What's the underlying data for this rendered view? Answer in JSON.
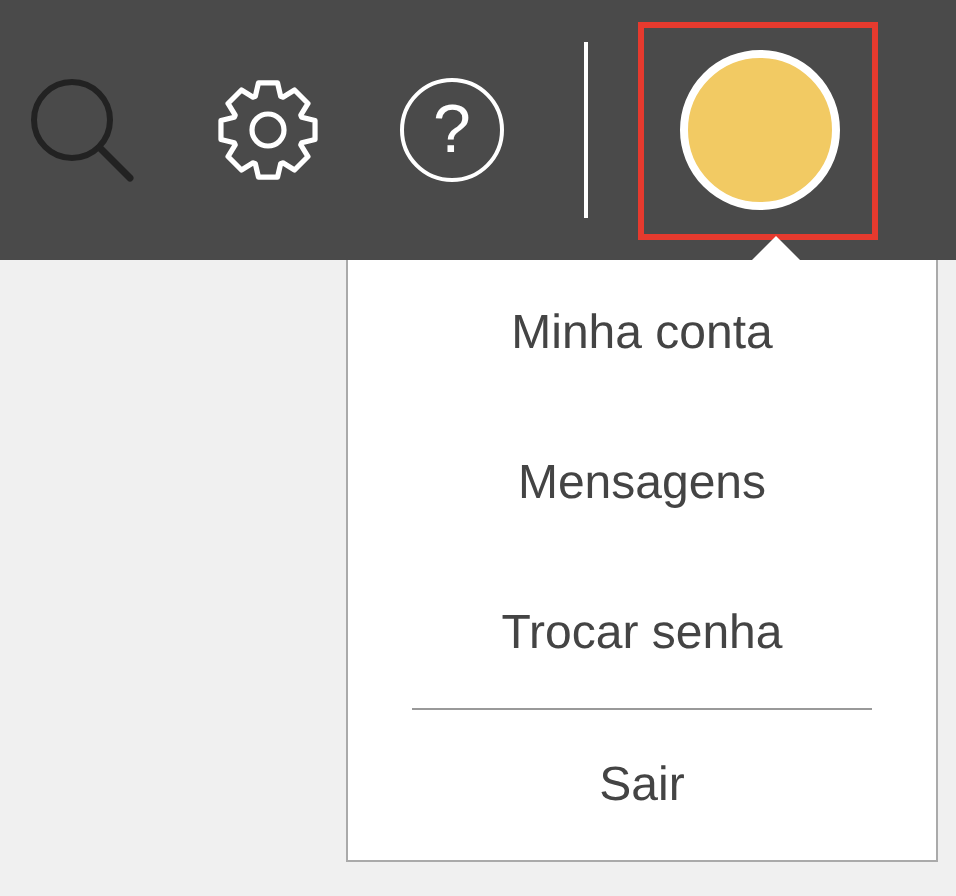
{
  "toolbar": {
    "help_glyph": "?",
    "profile": {
      "highlighted": true,
      "color": "#f2ca63"
    }
  },
  "menu": [
    {
      "label": "Minha conta",
      "separated": false
    },
    {
      "label": "Mensagens",
      "separated": false
    },
    {
      "label": "Trocar senha",
      "separated": false
    },
    {
      "label": "Sair",
      "separated": true
    }
  ]
}
